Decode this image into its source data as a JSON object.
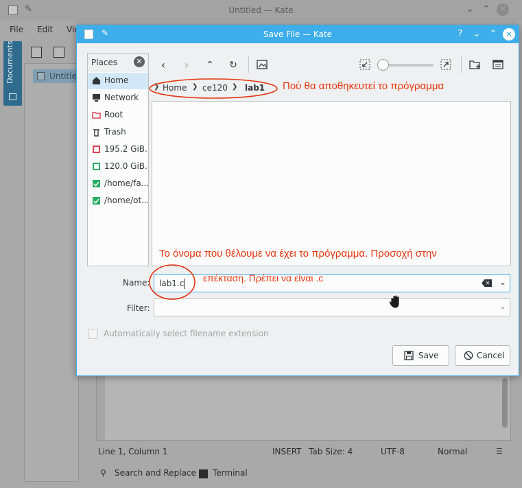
{
  "kate": {
    "window_title": "Untitled  — Kate",
    "menu": [
      "File",
      "Edit",
      "Vie"
    ],
    "sidebar_tab_label": "Documents",
    "doc_list_item": "Untitled",
    "status": {
      "cursor_position": "Line 1, Column 1",
      "mode": "INSERT",
      "tab_size": "Tab Size: 4",
      "encoding": "UTF-8",
      "highlighting": "Normal"
    },
    "bottom_tools": {
      "search": "Search and Replace",
      "terminal": "Terminal"
    }
  },
  "dialog": {
    "title": "Save File — Kate",
    "places": {
      "header": "Places",
      "items": [
        {
          "label": "Home",
          "icon": "home-icon",
          "selected": true
        },
        {
          "label": "Network",
          "icon": "network-icon"
        },
        {
          "label": "Root",
          "icon": "root-folder-icon"
        },
        {
          "label": "Trash",
          "icon": "trash-icon"
        },
        {
          "label": "195.2 GiB...",
          "icon": "drive-icon"
        },
        {
          "label": "120.0 GiB...",
          "icon": "drive-icon"
        },
        {
          "label": "/home/fa...",
          "icon": "mounted-drive-icon"
        },
        {
          "label": "/home/ot...",
          "icon": "mounted-drive-icon"
        }
      ]
    },
    "breadcrumb": [
      "Home",
      "ce120",
      "lab1"
    ],
    "name_label": "Name:",
    "name_value": "lab1.c",
    "filter_label": "Filter:",
    "filter_value": "",
    "auto_extension_label": "Automatically select filename extension",
    "auto_extension_checked": false,
    "save_label": "Save",
    "cancel_label": "Cancel",
    "zoom_slider_value": 0
  },
  "annotations": {
    "path_note": "Πού θα αποθηκευτεί το πρόγραμμα",
    "name_note_line1": "Το όνομα που θέλουμε να έχει το πρόγραμμα. Προσοχή στην",
    "name_note_line2": "επέκταση. Πρέπει να είναι .c"
  },
  "colors": {
    "accent": "#3daee9",
    "selection": "#d3e8f6",
    "annotation": "#e5360f"
  }
}
